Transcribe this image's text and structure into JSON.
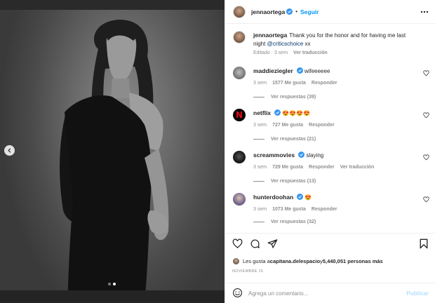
{
  "post": {
    "dots_total": 2,
    "dots_active": 2
  },
  "header": {
    "username": "jennaortega",
    "follow_label": "Seguir"
  },
  "caption": {
    "username": "jennaortega",
    "text": "Thank you for the honor and for having me last night ",
    "mention": "@criticschoice",
    "suffix": " xx",
    "edited": "Editado · 3 sem",
    "translate": "Ver traducción"
  },
  "comments": [
    {
      "username": "maddieziegler",
      "text": "wifeeeeee",
      "time": "3 sem",
      "likes": "1577 Me gusta",
      "reply": "Responder",
      "translate": "",
      "replies": "Ver respuestas (39)"
    },
    {
      "username": "netflix",
      "text": "😍😍😍😍",
      "time": "3 sem",
      "likes": "727 Me gusta",
      "reply": "Responder",
      "translate": "",
      "replies": "Ver respuestas (21)"
    },
    {
      "username": "screammovies",
      "text": "slaying",
      "time": "3 sem",
      "likes": "729 Me gusta",
      "reply": "Responder",
      "translate": "Ver traducción",
      "replies": "Ver respuestas (13)"
    },
    {
      "username": "hunterdoohan",
      "text": "😍",
      "time": "3 sem",
      "likes": "1073 Me gusta",
      "reply": "Responder",
      "translate": "",
      "replies": "Ver respuestas (32)"
    }
  ],
  "likes": {
    "prefix": "Les gusta a ",
    "user": "capitana.delespacio",
    "middle": " y ",
    "count": "5,440,051 personas más"
  },
  "date": "NOVIEMBRE 15",
  "comment_box": {
    "placeholder": "Agrega un comentario...",
    "publish_label": "Publicar"
  },
  "colors": {
    "accent": "#0095f6",
    "verified": "#3897f0",
    "publish_disabled": "#b2dffc",
    "muted": "#8e8e8e"
  }
}
